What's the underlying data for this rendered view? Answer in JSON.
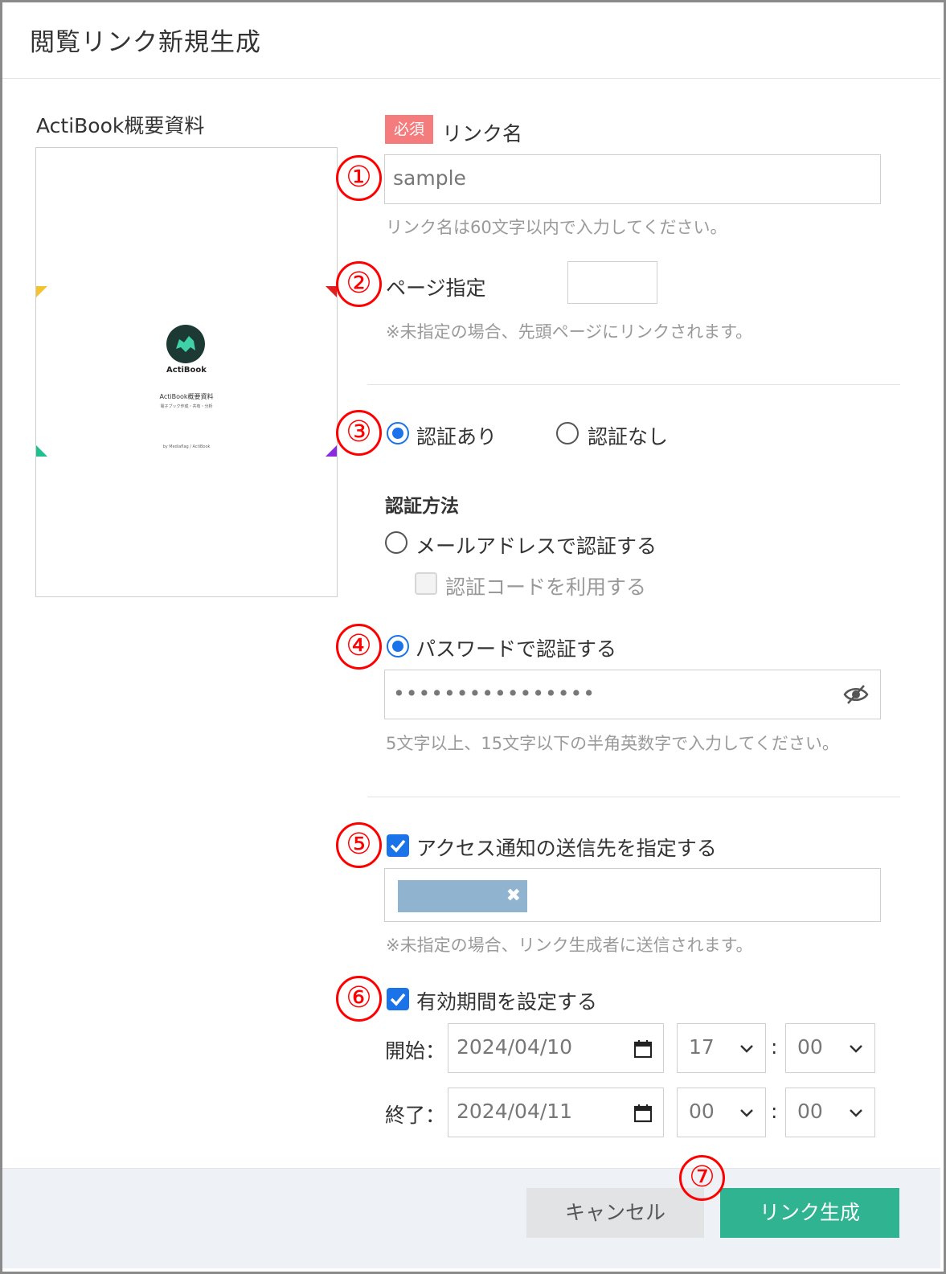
{
  "dialog": {
    "title": "閲覧リンク新規生成"
  },
  "document": {
    "title": "ActiBook概要資料",
    "thumbnail": {
      "brand": "ActiBook",
      "doc_title": "ActiBook概要資料",
      "subtitle": "電子ブック作成・共有・分析",
      "footer": "by Mediaflag / ActiBook"
    }
  },
  "form": {
    "required_badge": "必須",
    "link_name_label": "リンク名",
    "link_name_value": "sample",
    "link_name_hint": "リンク名は60文字以内で入力してください。",
    "page_label": "ページ指定",
    "page_value": "",
    "page_hint": "※未指定の場合、先頭ページにリンクされます。",
    "auth_on_label": "認証あり",
    "auth_off_label": "認証なし",
    "auth_method_title": "認証方法",
    "email_auth_label": "メールアドレスで認証する",
    "auth_code_label": "認証コードを利用する",
    "password_auth_label": "パスワードで認証する",
    "password_value": "••••••••••••••••",
    "password_hint": "5文字以上、15文字以下の半角英数字で入力してください。",
    "notify_label": "アクセス通知の送信先を指定する",
    "notify_chip_remove": "✖",
    "notify_hint": "※未指定の場合、リンク生成者に送信されます。",
    "expiry_label": "有効期間を設定する",
    "start_label": "開始：",
    "start_date": "2024/04/10",
    "start_hour": "17",
    "start_minute": "00",
    "end_label": "終了：",
    "end_date": "2024/04/11",
    "end_hour": "00",
    "end_minute": "00",
    "colon": ":"
  },
  "annotations": [
    "①",
    "②",
    "③",
    "④",
    "⑤",
    "⑥",
    "⑦"
  ],
  "buttons": {
    "cancel": "キャンセル",
    "create": "リンク生成"
  },
  "colors": {
    "accent": "#1a73e8",
    "primary_button": "#2fb391",
    "required_badge": "#f47c7c",
    "annotation": "#ff0000",
    "chip": "#90b3cf"
  },
  "icons": {
    "eye_toggle": "eye-slash-icon",
    "calendar": "calendar-icon",
    "chevron": "chevron-down-icon"
  }
}
